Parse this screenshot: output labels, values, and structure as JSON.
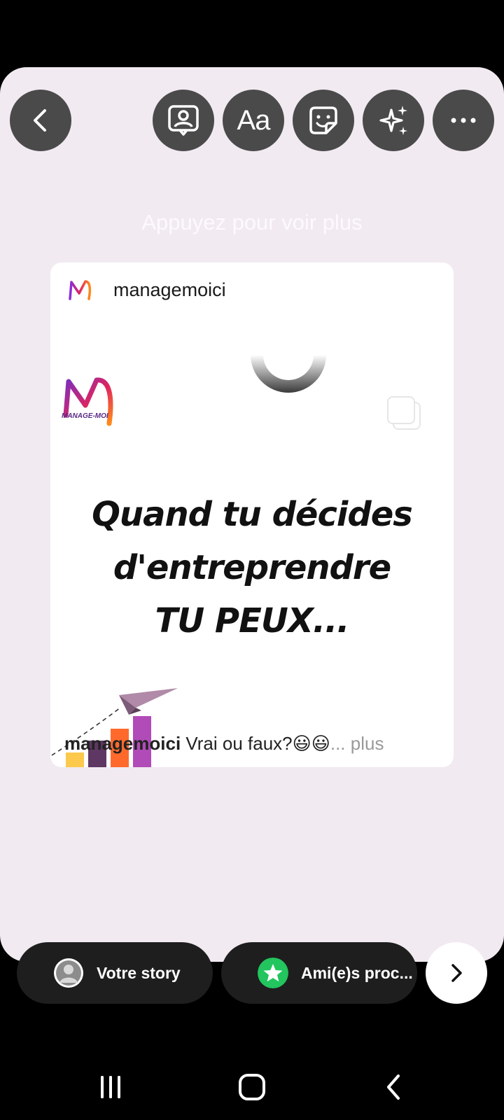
{
  "toolbar": {
    "back": "back",
    "tools": [
      "profile-tag",
      "text",
      "sticker",
      "effects",
      "more"
    ],
    "text_tool_label": "Aa"
  },
  "hint": {
    "tap_for_more": "Appuyez pour voir plus"
  },
  "post": {
    "username": "managemoici",
    "brand_logo_text": "MANAGE-MOI",
    "headline_lines": [
      "Quand tu décides",
      "d'entreprendre",
      "TU PEUX..."
    ],
    "caption_user": "managemoici",
    "caption_text": " Vrai ou faux?😃😃",
    "caption_more": "... plus"
  },
  "share": {
    "your_story": "Votre story",
    "close_friends": "Ami(e)s proc..."
  },
  "colors": {
    "canvas": "#f1eaf1",
    "tool_button": "#4a4a4a",
    "pill": "#1e1e1e",
    "close_friends_green": "#22c55e",
    "bars": [
      "#fcc94c",
      "#5e3763",
      "#ff6a2c",
      "#b14bb8"
    ]
  }
}
